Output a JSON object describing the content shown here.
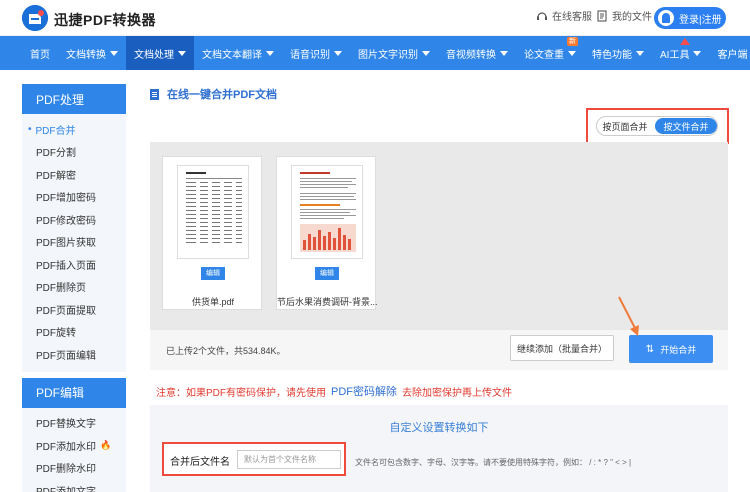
{
  "header": {
    "brand": "迅捷PDF转换器",
    "service": "在线客服",
    "files": "我的文件",
    "login": "登录|注册"
  },
  "nav": {
    "items": [
      {
        "label": "首页",
        "caret": false
      },
      {
        "label": "文档转换",
        "caret": true
      },
      {
        "label": "文档处理",
        "caret": true,
        "active": true
      },
      {
        "label": "文档文本翻译",
        "caret": true
      },
      {
        "label": "语音识别",
        "caret": true
      },
      {
        "label": "图片文字识别",
        "caret": true
      },
      {
        "label": "音视频转换",
        "caret": true
      },
      {
        "label": "论文查重",
        "caret": true,
        "badge": "新"
      },
      {
        "label": "特色功能",
        "caret": true
      },
      {
        "label": "AI工具",
        "caret": true,
        "flag": true
      },
      {
        "label": "客户端",
        "caret": true
      }
    ]
  },
  "sidebar": {
    "section1": "PDF处理",
    "items1": [
      "PDF合并",
      "PDF分割",
      "PDF解密",
      "PDF增加密码",
      "PDF修改密码",
      "PDF图片获取",
      "PDF插入页面",
      "PDF删除页",
      "PDF页面提取",
      "PDF旋转",
      "PDF页面编辑"
    ],
    "section2": "PDF编辑",
    "items2": [
      "PDF替换文字",
      "PDF添加水印",
      "PDF删除水印",
      "PDF添加文字"
    ]
  },
  "main": {
    "title": "在线一键合并PDF文档",
    "mode_page": "按页面合并",
    "mode_file": "按文件合并",
    "files": [
      {
        "name": "供货单.pdf",
        "edit": "编辑"
      },
      {
        "name": "节后水果消费调研-背景...",
        "edit": "编辑"
      }
    ],
    "upload_count": "已上传2个文件，共534.84K。",
    "continue_label": "继续添加（批量合并）",
    "start_label": "开始合并",
    "notice_pre": "注意：如果PDF有密码保护，请先使用",
    "notice_link": "PDF密码解除",
    "notice_post": "去除加密保护再上传文件",
    "settings_title": "自定义设置转换如下",
    "name_label": "合并后文件名",
    "name_placeholder": "默认为首个文件名称",
    "name_hint": "文件名可包含数字、字母、汉字等。请不要使用特殊字符，例如：  / : * ? \" < > |"
  },
  "colors": {
    "brand_blue": "#2f86e8",
    "highlight_red": "#ee4a3d",
    "notice_red": "#e03a2f"
  }
}
